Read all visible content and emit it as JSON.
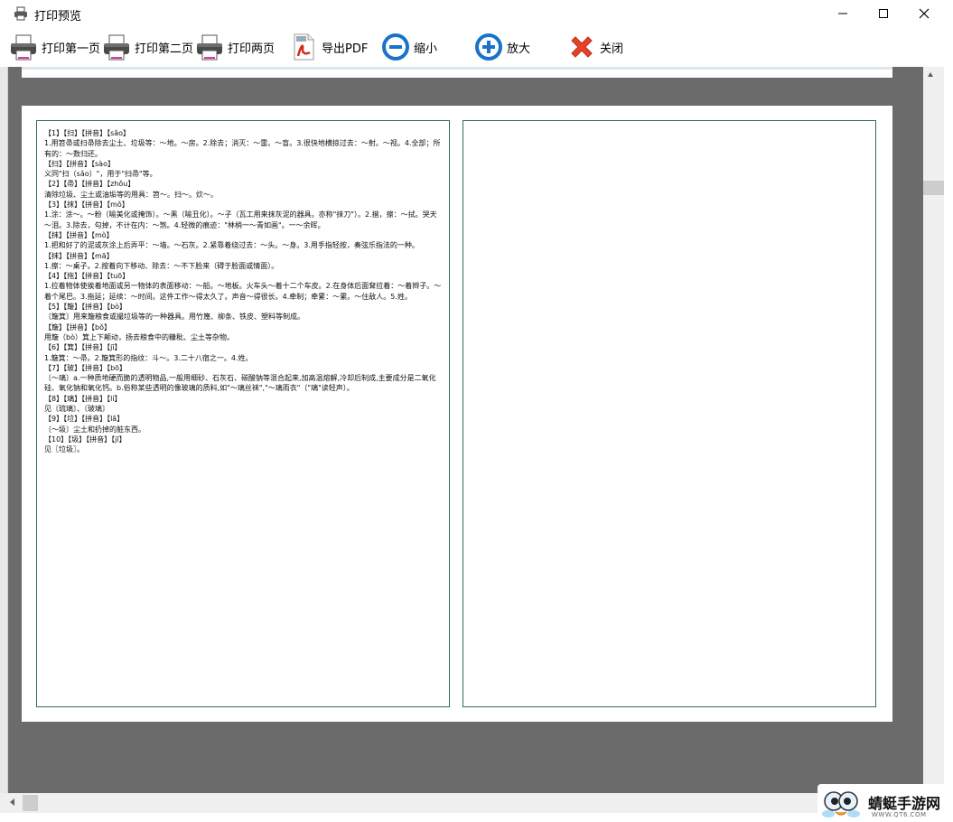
{
  "window": {
    "title": "打印预览"
  },
  "toolbar": {
    "print_first": "打印第一页",
    "print_second": "打印第二页",
    "print_both": "打印两页",
    "export_pdf": "导出PDF",
    "zoom_out": "缩小",
    "zoom_in": "放大",
    "close": "关闭"
  },
  "document": {
    "lines": [
      "【1】【扫】【拼音】【sǎo】",
      "1.用笤帚或扫帚除去尘土、垃圾等：～地。～房。2.除去；消灭：～雷。～盲。3.很快地横掠过去：～射。～视。4.全部；所有的：～数归还。",
      "【扫】【拼音】【sào】",
      "义同\"扫（sǎo）\"，用于\"扫帚\"等。",
      "【2】【帚】【拼音】【zhǒu】",
      "清除垃圾、尘土或油垢等的用具：笤～。扫～。炊～。",
      "【3】【抹】【拼音】【mǒ】",
      "1.涂：涂～。～粉（喻美化或掩饰）。～黑（喻丑化）。～子（瓦工用来抹灰泥的器具。亦称\"抹刀\"）。2.揩，擦：～拭。哭天～泪。3.除去，勾掉，不计在内：～煞。4.轻微的痕迹：\"林梢一～青如画\"。一～余晖。",
      "【抹】【拼音】【mò】",
      "1.把和好了的泥或灰涂上后弄平：～墙。～石灰。2.紧靠着绕过去：～头。～身。3.用手指轻按，奏弦乐指法的一种。",
      "【抹】【拼音】【mā】",
      "1.擦：～桌子。2.按着向下移动、除去：～不下脸来（碍于脸面或情面）。",
      "【4】【拖】【拼音】【tuō】",
      "1.拉着物体使挨着地面或另一物体的表面移动：～船。～地板。火车头～着十二个车皮。2.在身体后面耷拉着：～着辫子。～着个尾巴。3.拖延；延续：～时间。这件工作～得太久了。声音～得很长。4.牵制；牵累：～累。～住敌人。5.姓。",
      "【5】【簸】【拼音】【bò】",
      "〔簸箕〕用来簸粮食或撮垃圾等的一种器具。用竹篾、柳条、铁皮、塑料等制成。",
      "【簸】【拼音】【bǒ】",
      "用簸（bò）箕上下颠动，扬去粮食中的糠秕、尘土等杂物。",
      "【6】【箕】【拼音】【jī】",
      "1.簸箕：～帚。2.簸箕形的指纹：斗～。3.二十八宿之一。4.姓。",
      "【7】【玻】【拼音】【bō】",
      "〔～璃〕a.一种质地硬而脆的透明物品,一般用细砂、石灰石、碳酸钠等混合起来,加高温熔解,冷却后制成,主要成分是二氧化硅、氧化钠和氧化钙。b.俗称某些透明的像玻璃的质料,如\"～璃丝袜\",\"～璃雨衣\"（\"璃\"读轻声）。",
      "【8】【璃】【拼音】【lí】",
      "见〔琉璃〕、〔玻璃〕",
      "【9】【垃】【拼音】【lā】",
      "〔～圾〕尘土和扔掉的脏东西。",
      "【10】【圾】【拼音】【jī】",
      "见〖垃圾〗。"
    ]
  },
  "watermark": {
    "name": "蜻蜓手游网",
    "url": "WWW.QT6.COM"
  },
  "icons": {
    "printer": "printer-icon",
    "pdf": "pdf-icon",
    "zoom_out": "minus-circle-icon",
    "zoom_in": "plus-circle-icon",
    "close": "red-x-icon"
  },
  "colors": {
    "zoom_accent": "#1a73c9",
    "close_red": "#e8412a",
    "panel_border": "#2d6e5c"
  }
}
